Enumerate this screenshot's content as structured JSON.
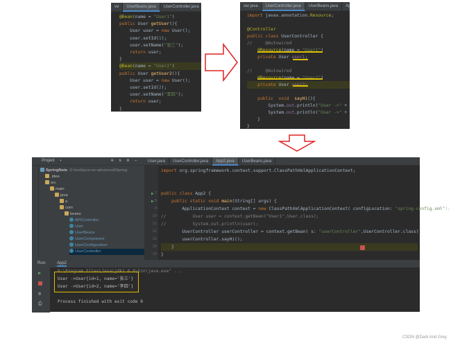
{
  "left_panel": {
    "tabs": [
      "ve",
      "UserBeans.java",
      "UserController.java"
    ],
    "code": [
      {
        "segments": [
          [
            "an",
            "@Bean"
          ],
          [
            "",
            "(name = "
          ],
          [
            "st",
            "\"User1\""
          ],
          [
            "",
            ")"
          ]
        ]
      },
      {
        "segments": [
          [
            "kw",
            "public "
          ],
          [
            "",
            "User "
          ],
          [
            "fn",
            "getUser"
          ],
          [
            "",
            "(){"
          ]
        ]
      },
      {
        "segments": [
          [
            "",
            "    User user = "
          ],
          [
            "kw",
            "new "
          ],
          [
            "",
            "User();"
          ]
        ]
      },
      {
        "segments": [
          [
            "",
            "    user.setId("
          ],
          [
            "num",
            "1"
          ],
          [
            "",
            ");"
          ]
        ]
      },
      {
        "segments": [
          [
            "",
            "    user.setName("
          ],
          [
            "st",
            "\"张三\""
          ],
          [
            "",
            ");"
          ]
        ]
      },
      {
        "segments": [
          [
            "kw",
            "    return "
          ],
          [
            "",
            "user;"
          ]
        ]
      },
      {
        "segments": [
          [
            "",
            "}"
          ]
        ]
      },
      {
        "segments": [
          [
            "an",
            "@Bean"
          ],
          [
            "",
            "(name = "
          ],
          [
            "st",
            "\"User2\""
          ],
          [
            "",
            ")"
          ]
        ],
        "highlight": true
      },
      {
        "segments": [
          [
            "kw",
            "public "
          ],
          [
            "",
            "User "
          ],
          [
            "fn",
            "getUser2"
          ],
          [
            "",
            "(){"
          ]
        ]
      },
      {
        "segments": [
          [
            "",
            "    User user = "
          ],
          [
            "kw",
            "new "
          ],
          [
            "",
            "User();"
          ]
        ]
      },
      {
        "segments": [
          [
            "",
            "    user.setId("
          ],
          [
            "num",
            "2"
          ],
          [
            "",
            ");"
          ]
        ]
      },
      {
        "segments": [
          [
            "",
            "    user.setName("
          ],
          [
            "st",
            "\"李四\""
          ],
          [
            "",
            ");"
          ]
        ]
      },
      {
        "segments": [
          [
            "kw",
            "    return "
          ],
          [
            "",
            "user;"
          ]
        ]
      },
      {
        "segments": [
          [
            "",
            "}"
          ]
        ]
      }
    ]
  },
  "right_panel": {
    "tabs": [
      "ser.java",
      "UserController.java",
      "UserBeans.java",
      "Ap"
    ],
    "code": [
      {
        "segments": [
          [
            "kw",
            "import "
          ],
          [
            "",
            "javax.annotation."
          ],
          [
            "an",
            "Resource"
          ],
          [
            "",
            ";"
          ]
        ]
      },
      {
        "segments": [
          [
            "",
            ""
          ]
        ]
      },
      {
        "segments": [
          [
            "an",
            "@Controller"
          ]
        ]
      },
      {
        "segments": [
          [
            "kw",
            "public class "
          ],
          [
            "",
            "UserController {"
          ]
        ]
      },
      {
        "segments": [
          [
            "cm",
            "//     @Autowired"
          ]
        ]
      },
      {
        "segments": [
          [
            "an",
            "    @Resource"
          ],
          [
            "",
            "(name = "
          ],
          [
            "st",
            "\"User1\""
          ],
          [
            "",
            ")"
          ]
        ]
      },
      {
        "segments": [
          [
            "kw",
            "    private "
          ],
          [
            "",
            "User "
          ],
          [
            "pu",
            "user1"
          ],
          [
            "",
            ";"
          ]
        ]
      },
      {
        "segments": [
          [
            "",
            ""
          ]
        ]
      },
      {
        "segments": [
          [
            "cm",
            "//     @Autowired"
          ]
        ]
      },
      {
        "segments": [
          [
            "an",
            "    @Resource"
          ],
          [
            "",
            "(name = "
          ],
          [
            "st",
            "\"User2\""
          ],
          [
            "",
            ")"
          ]
        ]
      },
      {
        "segments": [
          [
            "kw",
            "    private "
          ],
          [
            "",
            "User "
          ],
          [
            "pu",
            "user2"
          ],
          [
            "",
            ";"
          ]
        ],
        "highlight": true
      },
      {
        "segments": [
          [
            "",
            ""
          ]
        ]
      },
      {
        "segments": [
          [
            "kw",
            "    public  void  "
          ],
          [
            "fn",
            "sayHi"
          ],
          [
            "",
            "(){"
          ]
        ]
      },
      {
        "segments": [
          [
            "",
            "        System."
          ],
          [
            "pu",
            "out"
          ],
          [
            "",
            ".println("
          ],
          [
            "st",
            "\"User ->\" "
          ],
          [
            "",
            "+ "
          ],
          [
            "pu",
            "user1"
          ],
          [
            "",
            ");"
          ]
        ]
      },
      {
        "segments": [
          [
            "",
            "        System."
          ],
          [
            "pu",
            "out"
          ],
          [
            "",
            ".println("
          ],
          [
            "st",
            "\"User ->\" "
          ],
          [
            "",
            "+ "
          ],
          [
            "pu",
            "user2"
          ],
          [
            "",
            ");"
          ]
        ]
      },
      {
        "segments": [
          [
            "",
            "    }"
          ]
        ]
      },
      {
        "segments": [
          [
            "",
            "}"
          ]
        ]
      }
    ]
  },
  "ide": {
    "project_label": "Project",
    "tabs": [
      "User.java",
      "UserController.java",
      "App2.java",
      "UserBeans.java"
    ],
    "active_tab": 2,
    "tree": [
      {
        "label": "SpringNote",
        "extra": "G:\\test\\java-ee-advanced\\Spring",
        "indent": 0,
        "icon": "mod"
      },
      {
        "label": ".idea",
        "indent": 1,
        "icon": "folder"
      },
      {
        "label": "src",
        "indent": 1,
        "icon": "folder"
      },
      {
        "label": "main",
        "indent": 2,
        "icon": "folder"
      },
      {
        "label": "java",
        "indent": 3,
        "icon": "folder"
      },
      {
        "label": "a",
        "indent": 4,
        "icon": "folder"
      },
      {
        "label": "com",
        "indent": 4,
        "icon": "folder"
      },
      {
        "label": "beans",
        "indent": 5,
        "icon": "folder"
      },
      {
        "label": "APIController",
        "indent": 6,
        "icon": "class"
      },
      {
        "label": "User",
        "indent": 6,
        "icon": "class"
      },
      {
        "label": "UserBeans",
        "indent": 6,
        "icon": "class"
      },
      {
        "label": "UserComponent",
        "indent": 6,
        "icon": "class"
      },
      {
        "label": "UserConfiguration",
        "indent": 6,
        "icon": "class"
      },
      {
        "label": "UserController",
        "indent": 6,
        "icon": "class",
        "selected": true
      }
    ],
    "line_numbers": [
      "",
      "",
      "",
      "7",
      "8",
      "9",
      "10",
      "11",
      "12",
      "13",
      "14",
      "15"
    ],
    "code": [
      {
        "segments": [
          [
            "kw",
            "import "
          ],
          [
            "",
            "org.springframework.context.support.ClassPathXmlApplicationContext;"
          ]
        ]
      },
      {
        "segments": [
          [
            "",
            ""
          ]
        ]
      },
      {
        "segments": [
          [
            "",
            ""
          ]
        ]
      },
      {
        "segments": [
          [
            "kw",
            "public class "
          ],
          [
            "",
            "App2 {"
          ]
        ]
      },
      {
        "segments": [
          [
            "kw",
            "    public static void "
          ],
          [
            "fn",
            "main"
          ],
          [
            "",
            "(String[] args) {"
          ]
        ]
      },
      {
        "segments": [
          [
            "",
            "        ApplicationContext context = "
          ],
          [
            "kw",
            "new "
          ],
          [
            "",
            "ClassPathXmlApplicationContext( configLocation: "
          ],
          [
            "st",
            "\"spring-config.xml\""
          ],
          [
            "",
            ");"
          ]
        ]
      },
      {
        "segments": [
          [
            "cm",
            "//          User user = context.getBean(\"User1\",User.class);"
          ]
        ]
      },
      {
        "segments": [
          [
            "cm",
            "//          System.out.println(user);"
          ]
        ]
      },
      {
        "segments": [
          [
            "",
            "        UserController userController = context.getBean( s: "
          ],
          [
            "st",
            "\"userController\""
          ],
          [
            "",
            ",UserController.class);"
          ]
        ]
      },
      {
        "segments": [
          [
            "",
            "        userController.sayHi();"
          ]
        ]
      },
      {
        "segments": [
          [
            "",
            "    }"
          ]
        ],
        "highlight": true
      },
      {
        "segments": [
          [
            "",
            "}"
          ]
        ]
      }
    ],
    "run_label": "Run:",
    "run_tab": "App2",
    "output": [
      "D:\\Program Files\\Java\\jdk1.8.0\\bin\\java.exe\" ...",
      "User ->User{id=1, name='张三'}",
      "User ->User{id=2, name='李四'}",
      "",
      "Process finished with exit code 0"
    ]
  },
  "watermark": "CSDN @Dark And Grey",
  "colors": {
    "arrow": "#e02020",
    "underline": "#e0c000",
    "box": "#e0c000"
  }
}
